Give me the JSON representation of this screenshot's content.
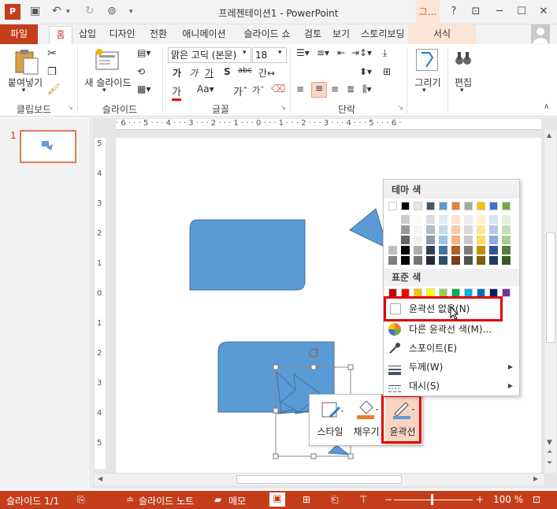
{
  "window": {
    "title": "프레젠테이션1 - PowerPoint",
    "context_tab": "그...",
    "help": "?"
  },
  "tabs": [
    {
      "label": "파일"
    },
    {
      "label": "홈"
    },
    {
      "label": "삽입"
    },
    {
      "label": "디자인"
    },
    {
      "label": "전환"
    },
    {
      "label": "애니메이션"
    },
    {
      "label": "슬라이드 쇼"
    },
    {
      "label": "검토"
    },
    {
      "label": "보기"
    },
    {
      "label": "스토리보딩"
    },
    {
      "label": "서식"
    }
  ],
  "ribbon": {
    "clipboard": {
      "paste": "붙여넣기",
      "group": "클립보드"
    },
    "slides": {
      "new_slide": "새 슬라이드",
      "group": "슬라이드"
    },
    "font": {
      "font_name": "맑은 고딕 (본문)",
      "font_size": "18",
      "group": "글꼴"
    },
    "paragraph": {
      "group": "단락"
    },
    "drawing": {
      "draw": "그리기"
    },
    "editing": {
      "edit": "편집"
    }
  },
  "slides_panel": {
    "slide_number": "1"
  },
  "ruler": {
    "horizontal": "· 6 · · · 5 · · · 4 · · · 3 · · · 2 · · · 1 · · · 0 · · · 1 · · · 2 · · · 3 · · · 4 · · · 5 · · · 6 ·",
    "vertical": [
      "5",
      "4",
      "3",
      "2",
      "1",
      "0",
      "1",
      "2",
      "3",
      "4",
      "5"
    ]
  },
  "mini_toolbar": {
    "style": "스타일",
    "fill": "채우기",
    "outline": "윤곽선"
  },
  "outline_menu": {
    "theme_colors_header": "테마 색",
    "standard_colors_header": "표준 색",
    "no_outline": "윤곽선 없음(N)",
    "more_colors": "다른 윤곽선 색(M)...",
    "eyedropper": "스포이트(E)",
    "weight": "두께(W)",
    "dashes": "대시(S)"
  },
  "theme_colors": [
    "#ffffff",
    "#000000",
    "#e7e6e6",
    "#44546a",
    "#5b9bd5",
    "#ed7d31",
    "#a5a5a5",
    "#ffc000",
    "#4472c4",
    "#70ad47"
  ],
  "standard_colors": [
    "#c00000",
    "#ff0000",
    "#ffc000",
    "#ffff00",
    "#92d050",
    "#00b050",
    "#00b0f0",
    "#0070c0",
    "#002060",
    "#7030a0"
  ],
  "status_bar": {
    "slide": "슬라이드 1/1",
    "notes": "슬라이드 노트",
    "comments": "메모",
    "zoom": "100 %"
  },
  "colors": {
    "brand": "#c43e1c",
    "shape_fill": "#5b9bd5",
    "highlight": "#e00000"
  }
}
